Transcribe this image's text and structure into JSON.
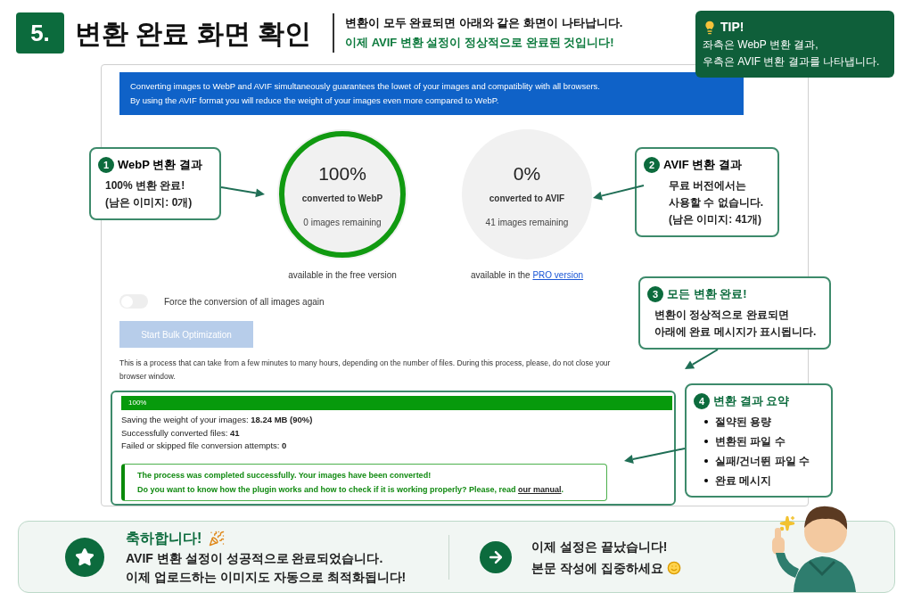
{
  "header": {
    "step": "5.",
    "title": "변환 완료 화면 확인",
    "subtitle_lines": [
      "변환이 모두 완료되면 아래와 같은 화면이 나타납니다.",
      "이제 AVIF 변환 설정이 정상적으로 완료된 것입니다!"
    ]
  },
  "tip": {
    "title": "TIP!",
    "lines": [
      "좌측은 WebP 변환 결과,",
      "우측은 AVIF 변환 결과를 나타냅니다."
    ]
  },
  "plugin": {
    "notice_lines": [
      "Converting images to WebP and AVIF simultaneously guarantees the lowet of your images and compatiblity with all browsers.",
      "By using the AVIF format you will reduce the weight of your images even more compared to WebP."
    ],
    "formats": [
      {
        "percent": "100%",
        "label": "converted to WebP",
        "remaining": "0 images remaining",
        "complete": true,
        "availability": "available in the free version"
      },
      {
        "percent": "0%",
        "label": "converted to AVIF",
        "remaining": "41 images remaining",
        "complete": false,
        "availability": "available in the ",
        "link": "PRO version"
      }
    ],
    "toggle": {
      "label": "Force the conversion of all images again",
      "on": false
    },
    "button": {
      "label": "Start Bulk Optimization",
      "disabled": true
    },
    "note": "This is a process that can take from a few minutes to many hours, depending on the number of files. During this process, please, do not close your browser window.",
    "progress": {
      "label": "100%",
      "level": 1
    },
    "stats": [
      {
        "label": "Saving the weight of your images: ",
        "value": "18.24 MB (90%)"
      },
      {
        "label": "Successfully converted files: ",
        "value": "41"
      },
      {
        "label": "Failed or skipped file conversion attempts: ",
        "value": "0"
      }
    ],
    "message": {
      "line": "The process was completed successfully. Your images have been converted!",
      "question": "Do you want to know how the plugin works and how to check if it is working properly? Please, read ",
      "link": "our manual",
      "end": "."
    }
  },
  "callouts": [
    {
      "kind": "text",
      "number": "1",
      "title": "WebP 변환 결과",
      "highlight": false,
      "lines": [
        "100% 변환 완료!",
        "(남은 이미지: 0개)"
      ]
    },
    {
      "kind": "text",
      "number": "2",
      "title": "AVIF 변환 결과",
      "highlight": false,
      "lines": [
        "무료 버전에서는",
        "사용할 수 없습니다.",
        "(남은 이미지: 41개)"
      ]
    },
    {
      "kind": "text",
      "number": "3",
      "title": "모든 변환 완료!",
      "highlight": true,
      "lines": [
        "변환이 정상적으로 완료되면",
        "아래에 완료 메시지가 표시됩니다."
      ]
    },
    {
      "kind": "list",
      "number": "4",
      "title": "변환 결과 요약",
      "highlight": true,
      "lines": [
        "절약된 용량",
        "변환된 파일 수",
        "실패/건너뛴 파일 수",
        "완료 메시지"
      ]
    }
  ],
  "banner": {
    "title": "축하합니다!",
    "lines": [
      "AVIF 변환 설정이 성공적으로 완료되었습니다.",
      "이제 업로드하는 이미지도 자동으로 최적화됩니다!"
    ],
    "next_lines": [
      "이제 설정은 끝났습니다!",
      "본문 작성에 집중하세요"
    ]
  }
}
